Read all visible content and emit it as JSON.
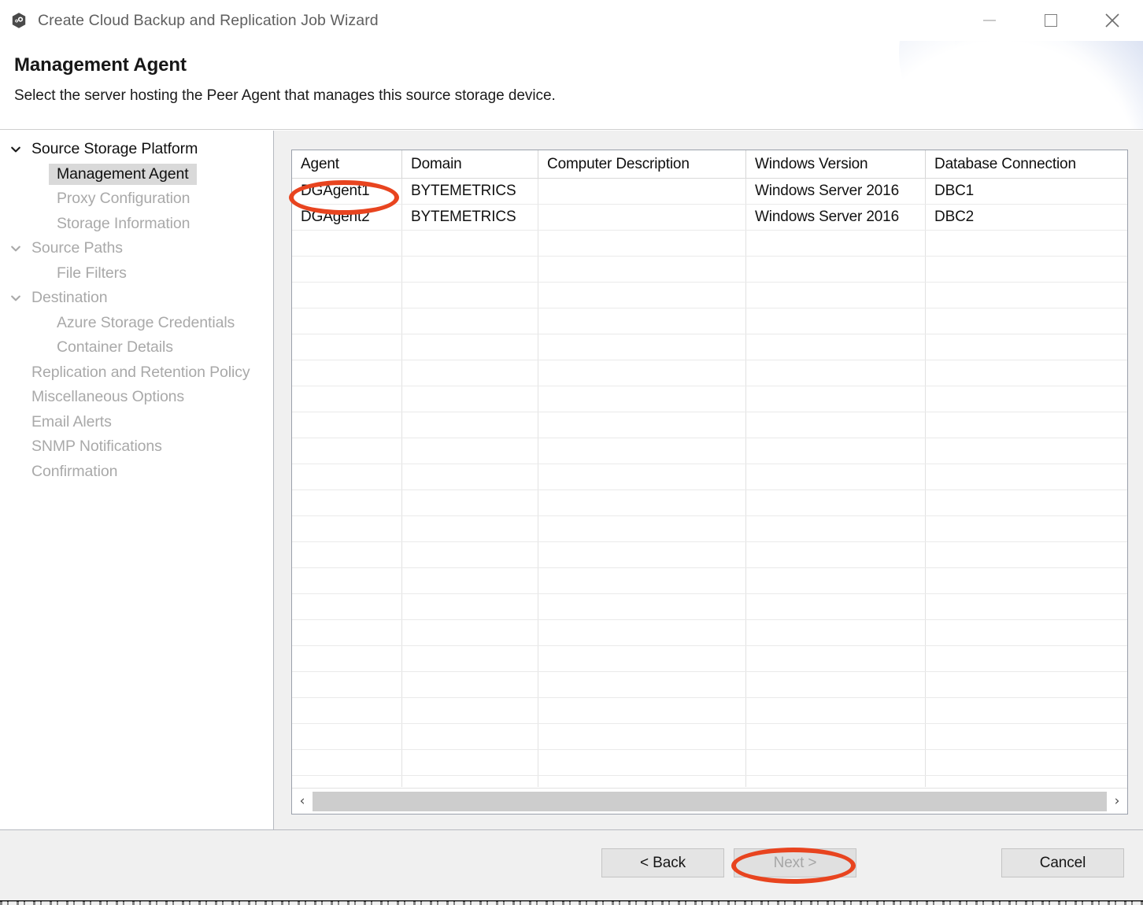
{
  "window": {
    "title": "Create Cloud Backup and Replication Job Wizard",
    "app_icon": "hexagon-app-icon",
    "controls": {
      "minimize": "minimize-icon",
      "maximize": "maximize-icon",
      "close": "✕"
    }
  },
  "header": {
    "title": "Management Agent",
    "subtitle": "Select the server hosting the Peer Agent that manages this source storage device."
  },
  "sidebar": {
    "items": [
      {
        "label": "Source Storage Platform",
        "level": 0,
        "chevron": "chevron-down-icon",
        "state": "strong"
      },
      {
        "label": "Management Agent",
        "level": 1,
        "chevron": "",
        "state": "active"
      },
      {
        "label": "Proxy Configuration",
        "level": 1,
        "chevron": "",
        "state": "dim"
      },
      {
        "label": "Storage Information",
        "level": 1,
        "chevron": "",
        "state": "dim"
      },
      {
        "label": "Source Paths",
        "level": 0,
        "chevron": "chevron-down-icon",
        "state": "dim"
      },
      {
        "label": "File Filters",
        "level": 1,
        "chevron": "",
        "state": "dim"
      },
      {
        "label": "Destination",
        "level": 0,
        "chevron": "chevron-down-icon",
        "state": "dim"
      },
      {
        "label": "Azure Storage Credentials",
        "level": 1,
        "chevron": "",
        "state": "dim"
      },
      {
        "label": "Container Details",
        "level": 1,
        "chevron": "",
        "state": "dim"
      },
      {
        "label": "Replication and Retention Policy",
        "level": 0,
        "chevron": "",
        "state": "dim"
      },
      {
        "label": "Miscellaneous Options",
        "level": 0,
        "chevron": "",
        "state": "dim"
      },
      {
        "label": "Email Alerts",
        "level": 0,
        "chevron": "",
        "state": "dim"
      },
      {
        "label": "SNMP Notifications",
        "level": 0,
        "chevron": "",
        "state": "dim"
      },
      {
        "label": "Confirmation",
        "level": 0,
        "chevron": "",
        "state": "dim"
      }
    ]
  },
  "table": {
    "columns": [
      "Agent",
      "Domain",
      "Computer Description",
      "Windows Version",
      "Database Connection"
    ],
    "rows": [
      [
        "DGAgent1",
        "BYTEMETRICS",
        "",
        "Windows Server 2016",
        "DBC1"
      ],
      [
        "DGAgent2",
        "BYTEMETRICS",
        "",
        "Windows Server 2016",
        "DBC2"
      ]
    ],
    "empty_row_count": 22,
    "scrollbar": {
      "left_arrow": "‹",
      "right_arrow": "›"
    }
  },
  "footer": {
    "back_label": "< Back",
    "next_label": "Next >",
    "next_disabled": true,
    "cancel_label": "Cancel"
  },
  "annotations": {
    "color": "#e8441f",
    "targets": [
      "agent-cell-dgagent1",
      "next-button"
    ]
  }
}
